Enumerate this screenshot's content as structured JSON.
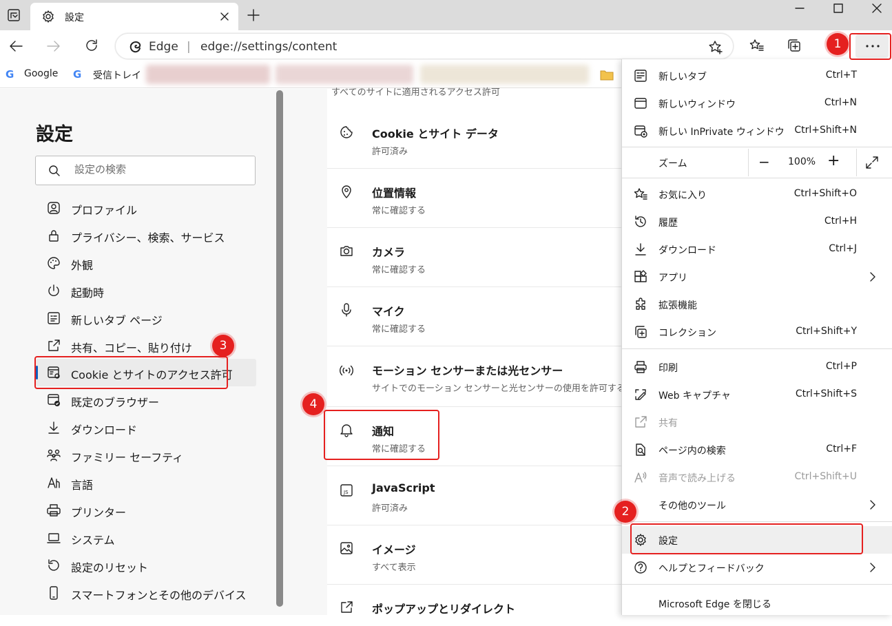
{
  "tab": {
    "title": "設定"
  },
  "address": {
    "brand": "Edge",
    "separator": "|",
    "url": "edge://settings/content"
  },
  "bookmarks": [
    {
      "label": "Google"
    },
    {
      "label": "受信トレイ"
    }
  ],
  "sidebar": {
    "heading": "設定",
    "search_placeholder": "設定の検索",
    "items": [
      {
        "label": "プロファイル",
        "icon": "profile-icon"
      },
      {
        "label": "プライバシー、検索、サービス",
        "icon": "lock-icon"
      },
      {
        "label": "外観",
        "icon": "palette-icon"
      },
      {
        "label": "起動時",
        "icon": "power-icon"
      },
      {
        "label": "新しいタブ ページ",
        "icon": "new-tab-page-icon"
      },
      {
        "label": "共有、コピー、貼り付け",
        "icon": "share-icon"
      },
      {
        "label": "Cookie とサイトのアクセス許可",
        "icon": "site-permissions-icon",
        "selected": true
      },
      {
        "label": "既定のブラウザー",
        "icon": "default-browser-icon"
      },
      {
        "label": "ダウンロード",
        "icon": "download-icon"
      },
      {
        "label": "ファミリー セーフティ",
        "icon": "family-icon"
      },
      {
        "label": "言語",
        "icon": "language-icon"
      },
      {
        "label": "プリンター",
        "icon": "printer-icon"
      },
      {
        "label": "システム",
        "icon": "laptop-icon"
      },
      {
        "label": "設定のリセット",
        "icon": "reset-icon"
      },
      {
        "label": "スマートフォンとその他のデバイス",
        "icon": "phone-icon"
      }
    ]
  },
  "content": {
    "top_cut_text": "すべてのサイトに適用されるアクセス許可",
    "rows": [
      {
        "title": "Cookie とサイト データ",
        "subtitle": "許可済み",
        "icon": "cookie-icon"
      },
      {
        "title": "位置情報",
        "subtitle": "常に確認する",
        "icon": "location-icon"
      },
      {
        "title": "カメラ",
        "subtitle": "常に確認する",
        "icon": "camera-icon"
      },
      {
        "title": "マイク",
        "subtitle": "常に確認する",
        "icon": "microphone-icon"
      },
      {
        "title": "モーション センサーまたは光センサー",
        "subtitle": "サイトでのモーション センサーと光センサーの使用を許可する",
        "icon": "motion-sensor-icon"
      },
      {
        "title": "通知",
        "subtitle": "常に確認する",
        "icon": "bell-icon"
      },
      {
        "title": "JavaScript",
        "subtitle": "許可済み",
        "icon": "javascript-icon"
      },
      {
        "title": "イメージ",
        "subtitle": "すべて表示",
        "icon": "image-icon"
      },
      {
        "title": "ポップアップとリダイレクト",
        "subtitle": "",
        "icon": "popup-icon"
      }
    ]
  },
  "menu": {
    "new_tab": {
      "label": "新しいタブ",
      "shortcut": "Ctrl+T"
    },
    "new_window": {
      "label": "新しいウィンドウ",
      "shortcut": "Ctrl+N"
    },
    "new_inprivate": {
      "label": "新しい InPrivate ウィンドウ",
      "shortcut": "Ctrl+Shift+N"
    },
    "zoom": {
      "label": "ズーム",
      "minus": "−",
      "value": "100%",
      "plus": "+"
    },
    "favorites": {
      "label": "お気に入り",
      "shortcut": "Ctrl+Shift+O"
    },
    "history": {
      "label": "履歴",
      "shortcut": "Ctrl+H"
    },
    "downloads": {
      "label": "ダウンロード",
      "shortcut": "Ctrl+J"
    },
    "apps": {
      "label": "アプリ"
    },
    "extensions": {
      "label": "拡張機能"
    },
    "collections": {
      "label": "コレクション",
      "shortcut": "Ctrl+Shift+Y"
    },
    "print": {
      "label": "印刷",
      "shortcut": "Ctrl+P"
    },
    "web_capture": {
      "label": "Web キャプチャ",
      "shortcut": "Ctrl+Shift+S"
    },
    "share": {
      "label": "共有"
    },
    "find": {
      "label": "ページ内の検索",
      "shortcut": "Ctrl+F"
    },
    "read_aloud": {
      "label": "音声で読み上げる",
      "shortcut": "Ctrl+Shift+U"
    },
    "more_tools": {
      "label": "その他のツール"
    },
    "settings": {
      "label": "設定"
    },
    "help": {
      "label": "ヘルプとフィードバック"
    },
    "close": {
      "label": "Microsoft Edge を閉じる"
    }
  },
  "callouts": {
    "b1": "1",
    "b2": "2",
    "b3": "3",
    "b4": "4"
  },
  "colors": {
    "callout": "#e5201f",
    "accent": "#0f5fbd"
  }
}
